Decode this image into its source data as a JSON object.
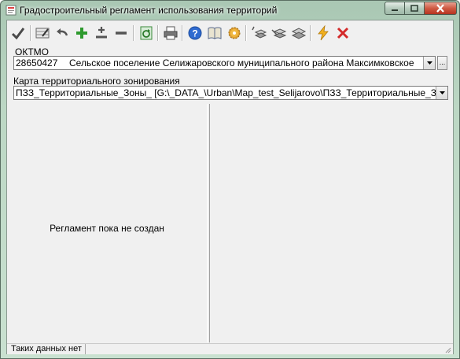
{
  "window": {
    "title": "Градостроительный регламент использования территорий",
    "accent": "#b53421"
  },
  "toolbar": {
    "buttons": [
      {
        "icon": "checkmark-icon"
      },
      {
        "icon": "edit-table-icon"
      },
      {
        "icon": "undo-arrow-icon"
      },
      {
        "icon": "plus-icon"
      },
      {
        "icon": "plus-minus-icon"
      },
      {
        "icon": "minus-icon"
      },
      {
        "icon": "refresh-icon"
      },
      {
        "icon": "printer-icon"
      },
      {
        "icon": "help-icon"
      },
      {
        "icon": "book-icon"
      },
      {
        "icon": "gear-icon"
      },
      {
        "icon": "layers-up-icon"
      },
      {
        "icon": "layers-down-icon"
      },
      {
        "icon": "layers-check-icon"
      },
      {
        "icon": "lightning-icon"
      },
      {
        "icon": "delete-x-icon"
      }
    ]
  },
  "oktmo": {
    "label": "ОКТМО",
    "code": "28650427",
    "name": "Сельское поселение Селижаровского муниципального района Максимковское"
  },
  "map": {
    "label": "Карта территориального зонирования",
    "value": "ПЗЗ_Территориальные_Зоны_ [G:\\_DATA_\\Urban\\Map_test_Selijarovo\\ПЗЗ_Территориальные_Зоны.sitx]"
  },
  "left_panel": {
    "message": "Регламент пока не создан"
  },
  "status": {
    "text": "Таких данных нет"
  }
}
